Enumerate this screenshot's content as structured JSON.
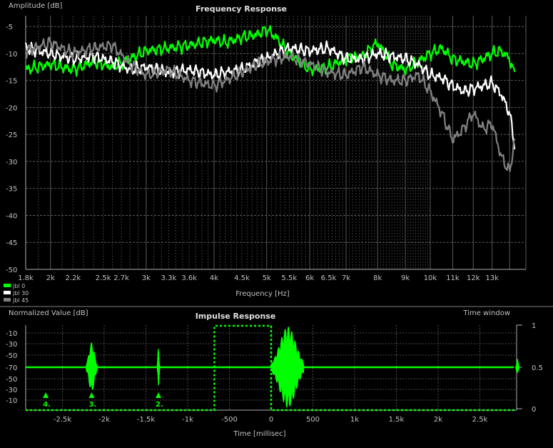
{
  "chart_data": [
    {
      "type": "line",
      "title": "Frequency Response",
      "ylabel": "Amplitude [dB]",
      "xlabel": "Frequency [Hz]",
      "x_scale": "log",
      "xlim": [
        1800,
        15000
      ],
      "ylim": [
        -50,
        -3
      ],
      "grid": true,
      "legend": "bottom-left",
      "y_ticks": [
        -5,
        -10,
        -15,
        -20,
        -25,
        -30,
        -35,
        -40,
        -45,
        -50
      ],
      "x_ticks": [
        {
          "v": 1800,
          "label": "1.8k"
        },
        {
          "v": 2000,
          "label": "2k"
        },
        {
          "v": 2200,
          "label": "2.2k"
        },
        {
          "v": 2500,
          "label": "2.5k"
        },
        {
          "v": 2700,
          "label": "2.7k"
        },
        {
          "v": 3000,
          "label": "3k"
        },
        {
          "v": 3300,
          "label": "3.3k"
        },
        {
          "v": 3600,
          "label": "3.6k"
        },
        {
          "v": 4000,
          "label": "4k"
        },
        {
          "v": 4500,
          "label": "4.5k"
        },
        {
          "v": 5000,
          "label": "5k"
        },
        {
          "v": 5500,
          "label": "5.5k"
        },
        {
          "v": 6000,
          "label": "6k"
        },
        {
          "v": 6500,
          "label": "6.5k"
        },
        {
          "v": 7000,
          "label": "7k"
        },
        {
          "v": 8000,
          "label": "8k"
        },
        {
          "v": 9000,
          "label": "9k"
        },
        {
          "v": 10000,
          "label": "10k"
        },
        {
          "v": 11000,
          "label": "11k"
        },
        {
          "v": 12000,
          "label": "12k"
        },
        {
          "v": 13000,
          "label": "13k"
        }
      ],
      "series": [
        {
          "name": "jbl 0",
          "color": "#00ff00",
          "x": [
            1800,
            2000,
            2200,
            2400,
            2600,
            2800,
            3000,
            3300,
            3600,
            4000,
            4200,
            4500,
            4800,
            5000,
            5200,
            5500,
            6000,
            6500,
            7000,
            7500,
            8000,
            8500,
            9000,
            9500,
            10000,
            10500,
            11000,
            11500,
            12000,
            12500,
            13000,
            13500,
            14000,
            14300
          ],
          "y": [
            -13,
            -12,
            -13,
            -11.5,
            -12.5,
            -11,
            -9.5,
            -9,
            -8.5,
            -7.5,
            -8,
            -7,
            -6.5,
            -5.5,
            -7,
            -10,
            -13,
            -12.5,
            -11,
            -10.5,
            -8,
            -12,
            -13,
            -11.5,
            -10,
            -9,
            -11,
            -11.5,
            -12,
            -11,
            -10,
            -9.5,
            -11,
            -14
          ]
        },
        {
          "name": "jbl 30",
          "color": "#ffffff",
          "x": [
            1800,
            2000,
            2200,
            2400,
            2600,
            2800,
            3000,
            3300,
            3600,
            4000,
            4200,
            4500,
            4800,
            5000,
            5200,
            5500,
            6000,
            6500,
            7000,
            7500,
            8000,
            8500,
            9000,
            9500,
            10000,
            10500,
            11000,
            11500,
            12000,
            12500,
            13000,
            13500,
            14000,
            14300
          ],
          "y": [
            -9,
            -10,
            -11,
            -10.5,
            -11.5,
            -13,
            -12.5,
            -13.5,
            -13,
            -14,
            -13.5,
            -13,
            -11.5,
            -11,
            -10,
            -9,
            -9.5,
            -9,
            -11,
            -11,
            -10,
            -10.5,
            -11,
            -12,
            -14,
            -14.5,
            -16,
            -17,
            -16.5,
            -16,
            -15.5,
            -17.5,
            -21,
            -27
          ]
        },
        {
          "name": "jbl 45",
          "color": "#808080",
          "x": [
            1800,
            2000,
            2200,
            2400,
            2600,
            2800,
            3000,
            3300,
            3600,
            4000,
            4200,
            4500,
            4800,
            5000,
            5200,
            5500,
            6000,
            6500,
            7000,
            7500,
            8000,
            8500,
            9000,
            9500,
            10000,
            10500,
            11000,
            11500,
            12000,
            12500,
            13000,
            13500,
            14000,
            14300
          ],
          "y": [
            -9.5,
            -8,
            -10,
            -9,
            -8.5,
            -12,
            -14,
            -13,
            -15,
            -16,
            -15,
            -13.5,
            -12,
            -11.5,
            -11,
            -10.5,
            -12,
            -13.5,
            -14,
            -12.5,
            -14,
            -15,
            -15,
            -14,
            -17,
            -21,
            -26,
            -24,
            -21,
            -24,
            -23,
            -29,
            -32,
            -26
          ]
        }
      ]
    },
    {
      "type": "line",
      "title": "Impulse Response",
      "ylabel": "Normalized Value [dB]",
      "y2label": "Time window",
      "xlabel": "Time [millisec]",
      "xlim": [
        -3000,
        3000
      ],
      "x_ticks": [
        {
          "v": -2500,
          "label": "-2.5k"
        },
        {
          "v": -2000,
          "label": "-2k"
        },
        {
          "v": -1500,
          "label": "-1.5k"
        },
        {
          "v": -1000,
          "label": "-1k"
        },
        {
          "v": -500,
          "label": "-500"
        },
        {
          "v": 0,
          "label": "0"
        },
        {
          "v": 500,
          "label": "500"
        },
        {
          "v": 1000,
          "label": "1k"
        },
        {
          "v": 1500,
          "label": "1.5k"
        },
        {
          "v": 2000,
          "label": "2k"
        },
        {
          "v": 2500,
          "label": "2.5k"
        }
      ],
      "y_ticks": [
        "-10",
        "-30",
        "-50",
        "-70",
        "-50",
        "-30",
        "-10"
      ],
      "y2_ticks": [
        "1",
        "0.5",
        "0"
      ],
      "time_window": {
        "start": -680,
        "end": 0,
        "color": "#00ff00"
      },
      "markers": [
        {
          "label": "4.",
          "t": -2700
        },
        {
          "label": "3.",
          "t": -2150
        },
        {
          "label": "2.",
          "t": -1350
        }
      ],
      "bursts": [
        {
          "t": -2150,
          "width": 130,
          "amp": 0.6
        },
        {
          "t": -1350,
          "width": 30,
          "amp": 0.5
        },
        {
          "t": 200,
          "width": 380,
          "amp": 0.98
        },
        {
          "t": 2950,
          "width": 40,
          "amp": 0.2
        }
      ]
    }
  ]
}
